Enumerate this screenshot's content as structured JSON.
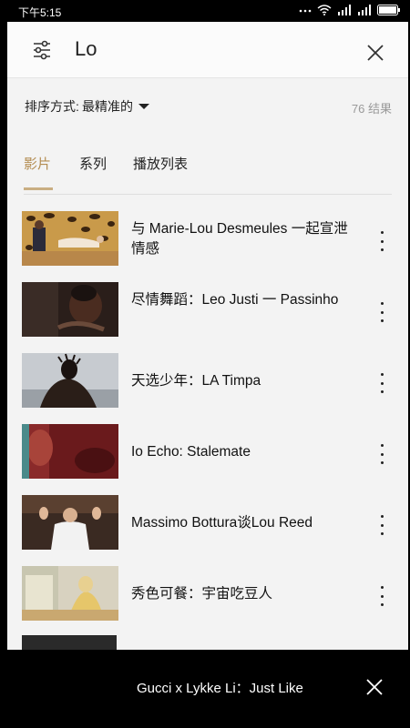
{
  "status_bar": {
    "time": "下午5:15",
    "icons": [
      "more-icon",
      "wifi-icon",
      "signal-icon",
      "signal-icon",
      "battery-icon"
    ]
  },
  "search": {
    "query": "Lo",
    "filter_icon": "sliders-icon",
    "close_icon": "close-icon"
  },
  "sort": {
    "label": "排序方式:",
    "selected": "最精准的",
    "result_count": "76 结果"
  },
  "tabs": [
    {
      "label": "影片",
      "active": true
    },
    {
      "label": "系列",
      "active": false
    },
    {
      "label": "播放列表",
      "active": false
    }
  ],
  "results": [
    {
      "title": "与 Marie-Lou Desmeules 一起宣泄情感",
      "thumbnail": "leopard-print-couch"
    },
    {
      "title": "尽情舞蹈：Leo Justi 一 Passinho",
      "thumbnail": "dancer-closeup"
    },
    {
      "title": "天选少年：LA Timpa",
      "thumbnail": "man-dreadlocks-back"
    },
    {
      "title": "Io Echo: Stalemate",
      "thumbnail": "red-abstract"
    },
    {
      "title": "Massimo Bottura谈Lou Reed",
      "thumbnail": "chef-in-kitchen"
    },
    {
      "title": "秀色可餐：宇宙吃豆人",
      "thumbnail": "woman-at-food-counter"
    }
  ],
  "mini_player": {
    "title": "Gucci x Lykke Li：Just Like",
    "close_icon": "close-icon"
  },
  "colors": {
    "accent": "#b48d52",
    "background": "#f3f3f3",
    "text": "#111111",
    "muted": "#9a9a9a"
  }
}
